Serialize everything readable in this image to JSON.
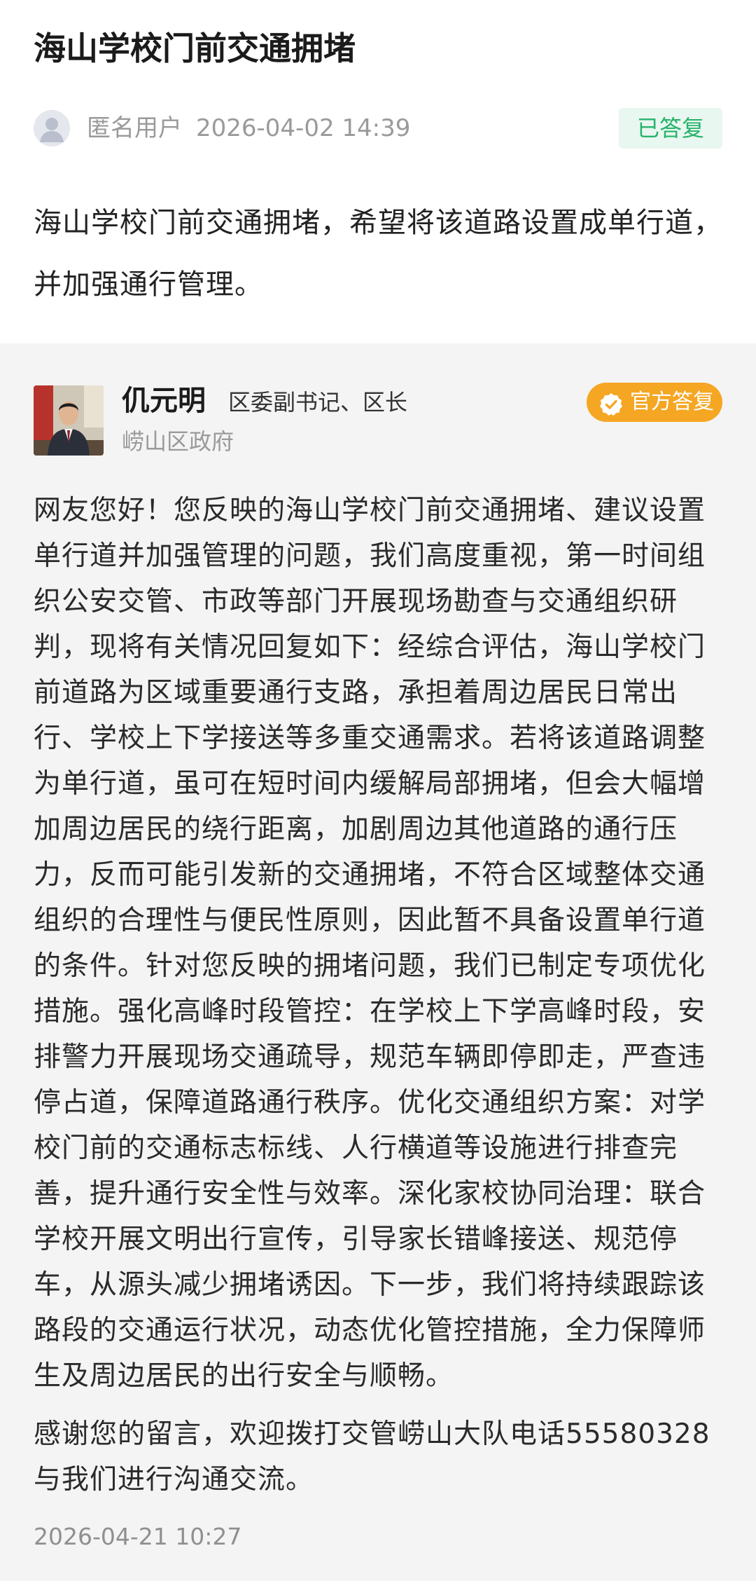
{
  "question": {
    "title": "海山学校门前交通拥堵",
    "asker_name": "匿名用户",
    "asker_time": "2026-04-02 14:39",
    "status_label": "已答复",
    "content": "海山学校门前交通拥堵，希望将该道路设置成单行道，并加强通行管理。"
  },
  "reply": {
    "official_name": "仉元明",
    "official_title": "区委副书记、区长",
    "official_org": "崂山区政府",
    "badge_label": "官方答复",
    "body": "网友您好！您反映的海山学校门前交通拥堵、建议设置单行道并加强管理的问题，我们高度重视，第一时间组织公安交管、市政等部门开展现场勘查与交通组织研判，现将有关情况回复如下：经综合评估，海山学校门前道路为区域重要通行支路，承担着周边居民日常出行、学校上下学接送等多重交通需求。若将该道路调整为单行道，虽可在短时间内缓解局部拥堵，但会大幅增加周边居民的绕行距离，加剧周边其他道路的通行压力，反而可能引发新的交通拥堵，不符合区域整体交通组织的合理性与便民性原则，因此暂不具备设置单行道的条件。针对您反映的拥堵问题，我们已制定专项优化措施。强化高峰时段管控：在学校上下学高峰时段，安排警力开展现场交通疏导，规范车辆即停即走，严查违停占道，保障道路通行秩序。优化交通组织方案：对学校门前的交通标志标线、人行横道等设施进行排查完善，提升通行安全性与效率。深化家校协同治理：联合学校开展文明出行宣传，引导家长错峰接送、规范停车，从源头减少拥堵诱因。下一步，我们将持续跟踪该路段的交通运行状况，动态优化管控措施，全力保障师生及周边居民的出行安全与顺畅。",
    "thanks": "感谢您的留言，欢迎拨打交管崂山大队电话55580328与我们进行沟通交流。",
    "reply_time": "2026-04-21 10:27"
  },
  "colors": {
    "answered_green": "#27b36b",
    "answered_bg": "#e8f7ef",
    "official_orange": "#f5a623",
    "page_bg": "#f4f4f4"
  },
  "icons": {
    "asker_avatar": "default-user-avatar-icon",
    "official_photo": "official-portrait",
    "badge_icon": "verified-check-icon"
  }
}
